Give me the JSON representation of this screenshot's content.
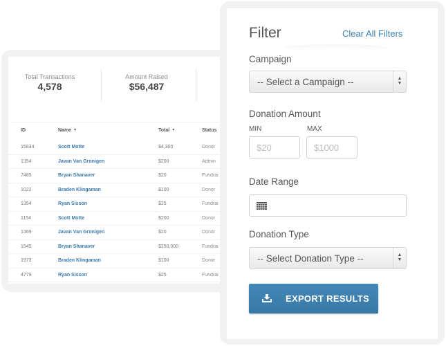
{
  "summary": {
    "stats": [
      {
        "label": "Total Transactions",
        "value": "4,578"
      },
      {
        "label": "Amount Raised",
        "value": "$56,487"
      }
    ]
  },
  "table": {
    "columns": [
      {
        "label": "ID",
        "sortable": false
      },
      {
        "label": "Name",
        "sortable": true
      },
      {
        "label": "Total",
        "sortable": true
      },
      {
        "label": "Status",
        "sortable": false
      }
    ],
    "sort_caret": "▼",
    "rows": [
      {
        "id": "15834",
        "name": "Scott Motte",
        "total": "$4,300",
        "status": "Donor"
      },
      {
        "id": "1354",
        "name": "Javan Van Gronigen",
        "total": "$200",
        "status": "Admin"
      },
      {
        "id": "7485",
        "name": "Bryan Shanaver",
        "total": "$20",
        "status": "Fundrai"
      },
      {
        "id": "1022",
        "name": "Braden Klingaman",
        "total": "$100",
        "status": "Donor"
      },
      {
        "id": "1354",
        "name": "Ryan Sisson",
        "total": "$25",
        "status": "Fundrai"
      },
      {
        "id": "1154",
        "name": "Scott Motte",
        "total": "$200",
        "status": "Donor"
      },
      {
        "id": "1369",
        "name": "Javan Van Gronigen",
        "total": "$20",
        "status": "Donor"
      },
      {
        "id": "1545",
        "name": "Bryan Shanaver",
        "total": "$250,000",
        "status": "Fundrai"
      },
      {
        "id": "1973",
        "name": "Braden Klingaman",
        "total": "$100",
        "status": "Donor"
      },
      {
        "id": "4779",
        "name": "Ryan Sisson",
        "total": "$25",
        "status": "Fundrai"
      }
    ]
  },
  "filter": {
    "title": "Filter",
    "clear_label": "Clear All Filters",
    "campaign": {
      "label": "Campaign",
      "selected": "-- Select a Campaign --"
    },
    "donation_amount": {
      "label": "Donation Amount",
      "min_label": "MIN",
      "max_label": "MAX",
      "min_placeholder": "$20",
      "max_placeholder": "$1000"
    },
    "date_range": {
      "label": "Date Range",
      "icon": "calendar-icon"
    },
    "donation_type": {
      "label": "Donation Type",
      "selected": "-- Select Donation Type --"
    },
    "export": {
      "label": "EXPORT RESULTS",
      "icon": "download-icon"
    }
  },
  "colors": {
    "accent": "#3a80b5",
    "button": "#3d80ae",
    "link_name": "#3a7ab0",
    "frame": "#f1f1f1"
  }
}
